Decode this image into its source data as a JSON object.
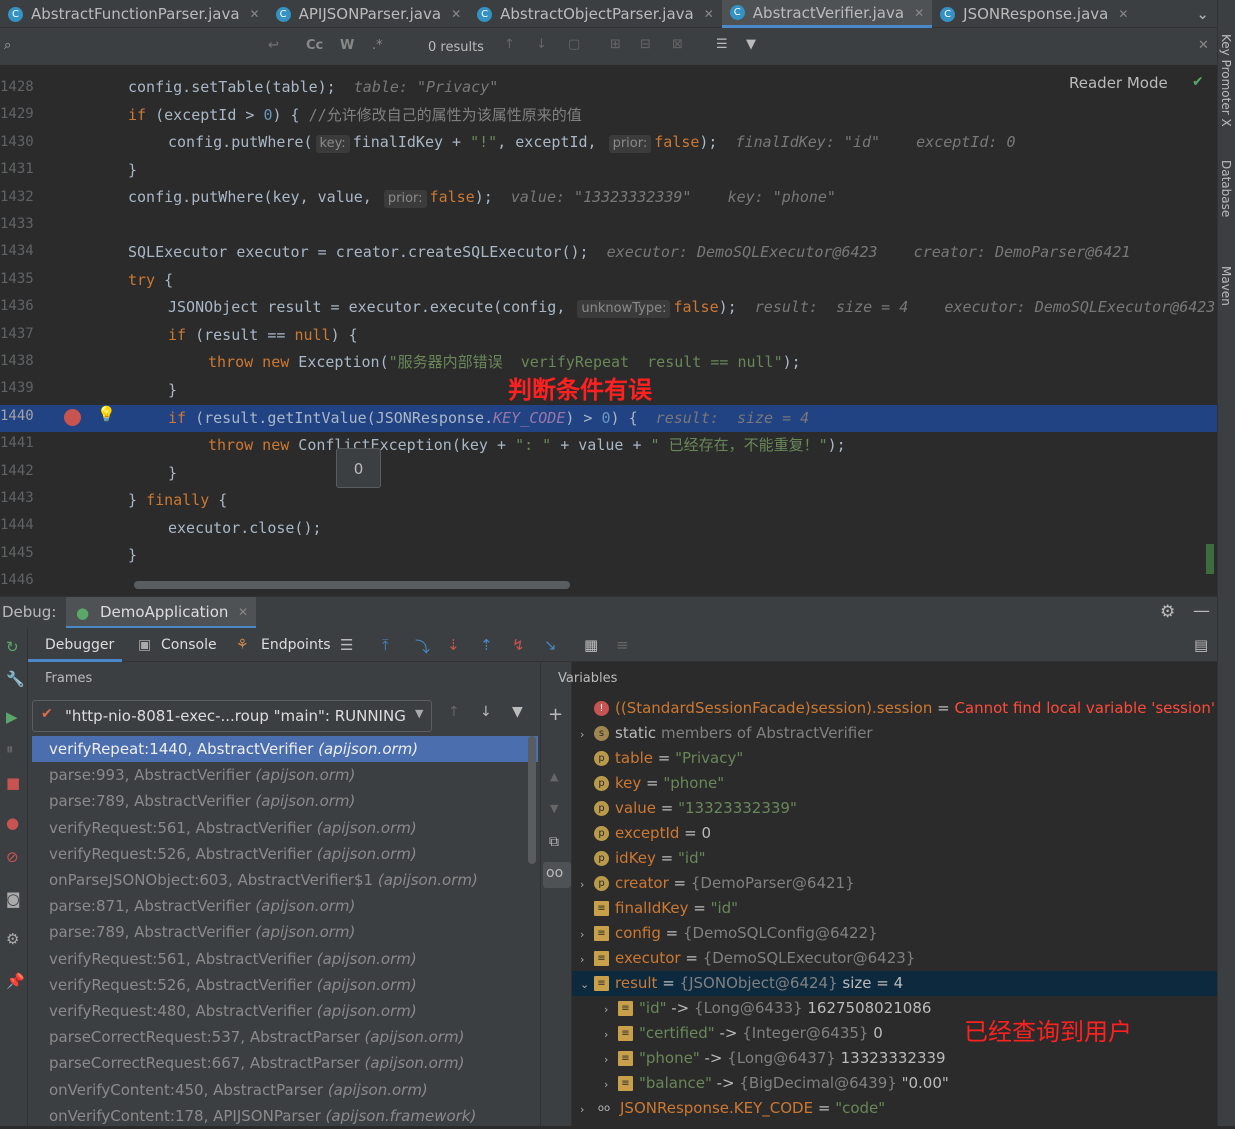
{
  "tabs": [
    {
      "label": "AbstractFunctionParser.java"
    },
    {
      "label": "APIJSONParser.java"
    },
    {
      "label": "AbstractObjectParser.java"
    },
    {
      "label": "AbstractVerifier.java",
      "active": true
    },
    {
      "label": "JSONResponse.java"
    }
  ],
  "findbar": {
    "results": "0 results",
    "cc": "Cc",
    "w": "W",
    "regex": ".*"
  },
  "right_strip": {
    "key_promoter": "Key Promoter X",
    "database": "Database",
    "maven": "Maven"
  },
  "editor": {
    "reader_mode": "Reader Mode",
    "line_numbers": [
      "1428",
      "1429",
      "1430",
      "1431",
      "1432",
      "1433",
      "1434",
      "1435",
      "1436",
      "1437",
      "1438",
      "1439",
      "1440",
      "1441",
      "1442",
      "1443",
      "1444",
      "1445",
      "1446"
    ],
    "lines": {
      "l1428_a": "config.setTable(table);",
      "l1428_hint": "table: \"Privacy\"",
      "l1429_if": "if",
      "l1429_a": " (exceptId > ",
      "l1429_num": "0",
      "l1429_b": ") { ",
      "l1429_cm": "//允许修改自己的属性为该属性原来的值",
      "l1430_a": "config.putWhere(",
      "l1430_p1": "key:",
      "l1430_b": "finalIdKey + ",
      "l1430_s": "\"!\"",
      "l1430_c": ", exceptId, ",
      "l1430_p2": "prior:",
      "l1430_f": "false",
      "l1430_d": ");",
      "l1430_hint": "finalIdKey: \"id\"    exceptId: 0",
      "l1431": "}",
      "l1432_a": "config.putWhere(key, value, ",
      "l1432_p": "prior:",
      "l1432_f": "false",
      "l1432_b": ");",
      "l1432_hint": "value: \"13323332339\"    key: \"phone\"",
      "l1434_a": "SQLExecutor executor = creator.createSQLExecutor();",
      "l1434_hint": "executor: DemoSQLExecutor@6423    creator: DemoParser@6421",
      "l1435_try": "try",
      "l1435_a": " {",
      "l1436_a": "JSONObject result = executor.execute(config, ",
      "l1436_p": "unknowType:",
      "l1436_f": "false",
      "l1436_b": ");",
      "l1436_hint": "result:  size = 4    executor: DemoSQLExecutor@6423",
      "l1437_if": "if",
      "l1437_a": " (result == ",
      "l1437_null": "null",
      "l1437_b": ") {",
      "l1438_kw": "throw new",
      "l1438_a": " Exception(",
      "l1438_s": "\"服务器内部错误  verifyRepeat  result == null\"",
      "l1438_b": ");",
      "l1439": "}",
      "l1440_if": "if",
      "l1440_a": " (result.getIntValue(JSONResponse.",
      "l1440_fld": "KEY_CODE",
      "l1440_b": ") > ",
      "l1440_num": "0",
      "l1440_c": ") {",
      "l1440_hint": "result:  size = 4",
      "l1441_kw": "throw new",
      "l1441_a": " ConflictException(key + ",
      "l1441_s1": "\": \"",
      "l1441_b": " + value + ",
      "l1441_s2": "\" 已经存在，不能重复！\"",
      "l1441_c": ");",
      "l1442": "}",
      "l1443_a": "} ",
      "l1443_fin": "finally",
      "l1443_b": " {",
      "l1444": "executor.close();",
      "l1445": "}"
    },
    "tooltip_value": "0",
    "annotation_condition": "判断条件有误"
  },
  "debug": {
    "label": "Debug:",
    "config": "DemoApplication",
    "tabs": {
      "debugger": "Debugger",
      "console": "Console",
      "endpoints": "Endpoints"
    },
    "frames_header": "Frames",
    "variables_header": "Variables",
    "thread": "\"http-nio-8081-exec-...roup \"main\": RUNNING",
    "frames": [
      {
        "method": "verifyRepeat:1440, AbstractVerifier",
        "pkg": "(apijson.orm)",
        "selected": true
      },
      {
        "method": "parse:993, AbstractVerifier",
        "pkg": "(apijson.orm)"
      },
      {
        "method": "parse:789, AbstractVerifier",
        "pkg": "(apijson.orm)"
      },
      {
        "method": "verifyRequest:561, AbstractVerifier",
        "pkg": "(apijson.orm)"
      },
      {
        "method": "verifyRequest:526, AbstractVerifier",
        "pkg": "(apijson.orm)"
      },
      {
        "method": "onParseJSONObject:603, AbstractVerifier$1",
        "pkg": "(apijson.orm)"
      },
      {
        "method": "parse:871, AbstractVerifier",
        "pkg": "(apijson.orm)"
      },
      {
        "method": "parse:789, AbstractVerifier",
        "pkg": "(apijson.orm)"
      },
      {
        "method": "verifyRequest:561, AbstractVerifier",
        "pkg": "(apijson.orm)"
      },
      {
        "method": "verifyRequest:526, AbstractVerifier",
        "pkg": "(apijson.orm)"
      },
      {
        "method": "verifyRequest:480, AbstractVerifier",
        "pkg": "(apijson.orm)"
      },
      {
        "method": "parseCorrectRequest:537, AbstractParser",
        "pkg": "(apijson.orm)"
      },
      {
        "method": "parseCorrectRequest:667, AbstractParser",
        "pkg": "(apijson.orm)"
      },
      {
        "method": "onVerifyContent:450, AbstractParser",
        "pkg": "(apijson.orm)"
      },
      {
        "method": "onVerifyContent:178, APIJSONParser",
        "pkg": "(apijson.framework)"
      }
    ],
    "variables": [
      {
        "icon": "error-icon",
        "name": "((StandardSessionFacade)session).session",
        "eq": " = ",
        "value": "Cannot find local variable 'session'",
        "kind": "err"
      },
      {
        "icon": "static-icon",
        "name": "static",
        "eq": " members of AbstractVerifier",
        "value": "",
        "kind": "static"
      },
      {
        "icon": "param-icon",
        "name": "table",
        "eq": " = ",
        "value": "\"Privacy\"",
        "kind": "str"
      },
      {
        "icon": "param-icon",
        "name": "key",
        "eq": " = ",
        "value": "\"phone\"",
        "kind": "str"
      },
      {
        "icon": "param-icon",
        "name": "value",
        "eq": " = ",
        "value": "\"13323332339\"",
        "kind": "str"
      },
      {
        "icon": "param-icon",
        "name": "exceptId",
        "eq": " = ",
        "value": "0",
        "kind": "num"
      },
      {
        "icon": "param-icon",
        "name": "idKey",
        "eq": " = ",
        "value": "\"id\"",
        "kind": "str"
      },
      {
        "icon": "param-icon",
        "name": "creator",
        "eq": " = ",
        "value": "{DemoParser@6421}",
        "kind": "obj"
      },
      {
        "icon": "field-icon",
        "name": "finalIdKey",
        "eq": " = ",
        "value": "\"id\"",
        "kind": "str"
      },
      {
        "icon": "field-icon",
        "name": "config",
        "eq": " = ",
        "value": "{DemoSQLConfig@6422}",
        "kind": "obj"
      },
      {
        "icon": "field-icon",
        "name": "executor",
        "eq": " = ",
        "value": "{DemoSQLExecutor@6423}",
        "kind": "obj"
      },
      {
        "icon": "field-icon",
        "name": "result",
        "eq": " = ",
        "value": "{JSONObject@6424}",
        "extra": " size = 4",
        "kind": "obj",
        "selected": true
      },
      {
        "icon": "field-icon",
        "name": "\"id\"",
        "eq": " -> ",
        "value": "{Long@6433}",
        "extra": " 1627508021086",
        "kind": "entry"
      },
      {
        "icon": "field-icon",
        "name": "\"certified\"",
        "eq": " -> ",
        "value": "{Integer@6435}",
        "extra": " 0",
        "kind": "entry"
      },
      {
        "icon": "field-icon",
        "name": "\"phone\"",
        "eq": " -> ",
        "value": "{Long@6437}",
        "extra": " 13323332339",
        "kind": "entry"
      },
      {
        "icon": "field-icon",
        "name": "\"balance\"",
        "eq": " -> ",
        "value": "{BigDecimal@6439}",
        "extra": " \"0.00\"",
        "kind": "entry"
      },
      {
        "icon": "watch-icon",
        "name": "JSONResponse.KEY_CODE",
        "eq": " = ",
        "value": "\"code\"",
        "kind": "str"
      }
    ],
    "annotation_found": "已经查询到用户"
  },
  "colors": {
    "accent": "#4a88c7",
    "selection": "#214283",
    "annotation": "#ff2020"
  }
}
